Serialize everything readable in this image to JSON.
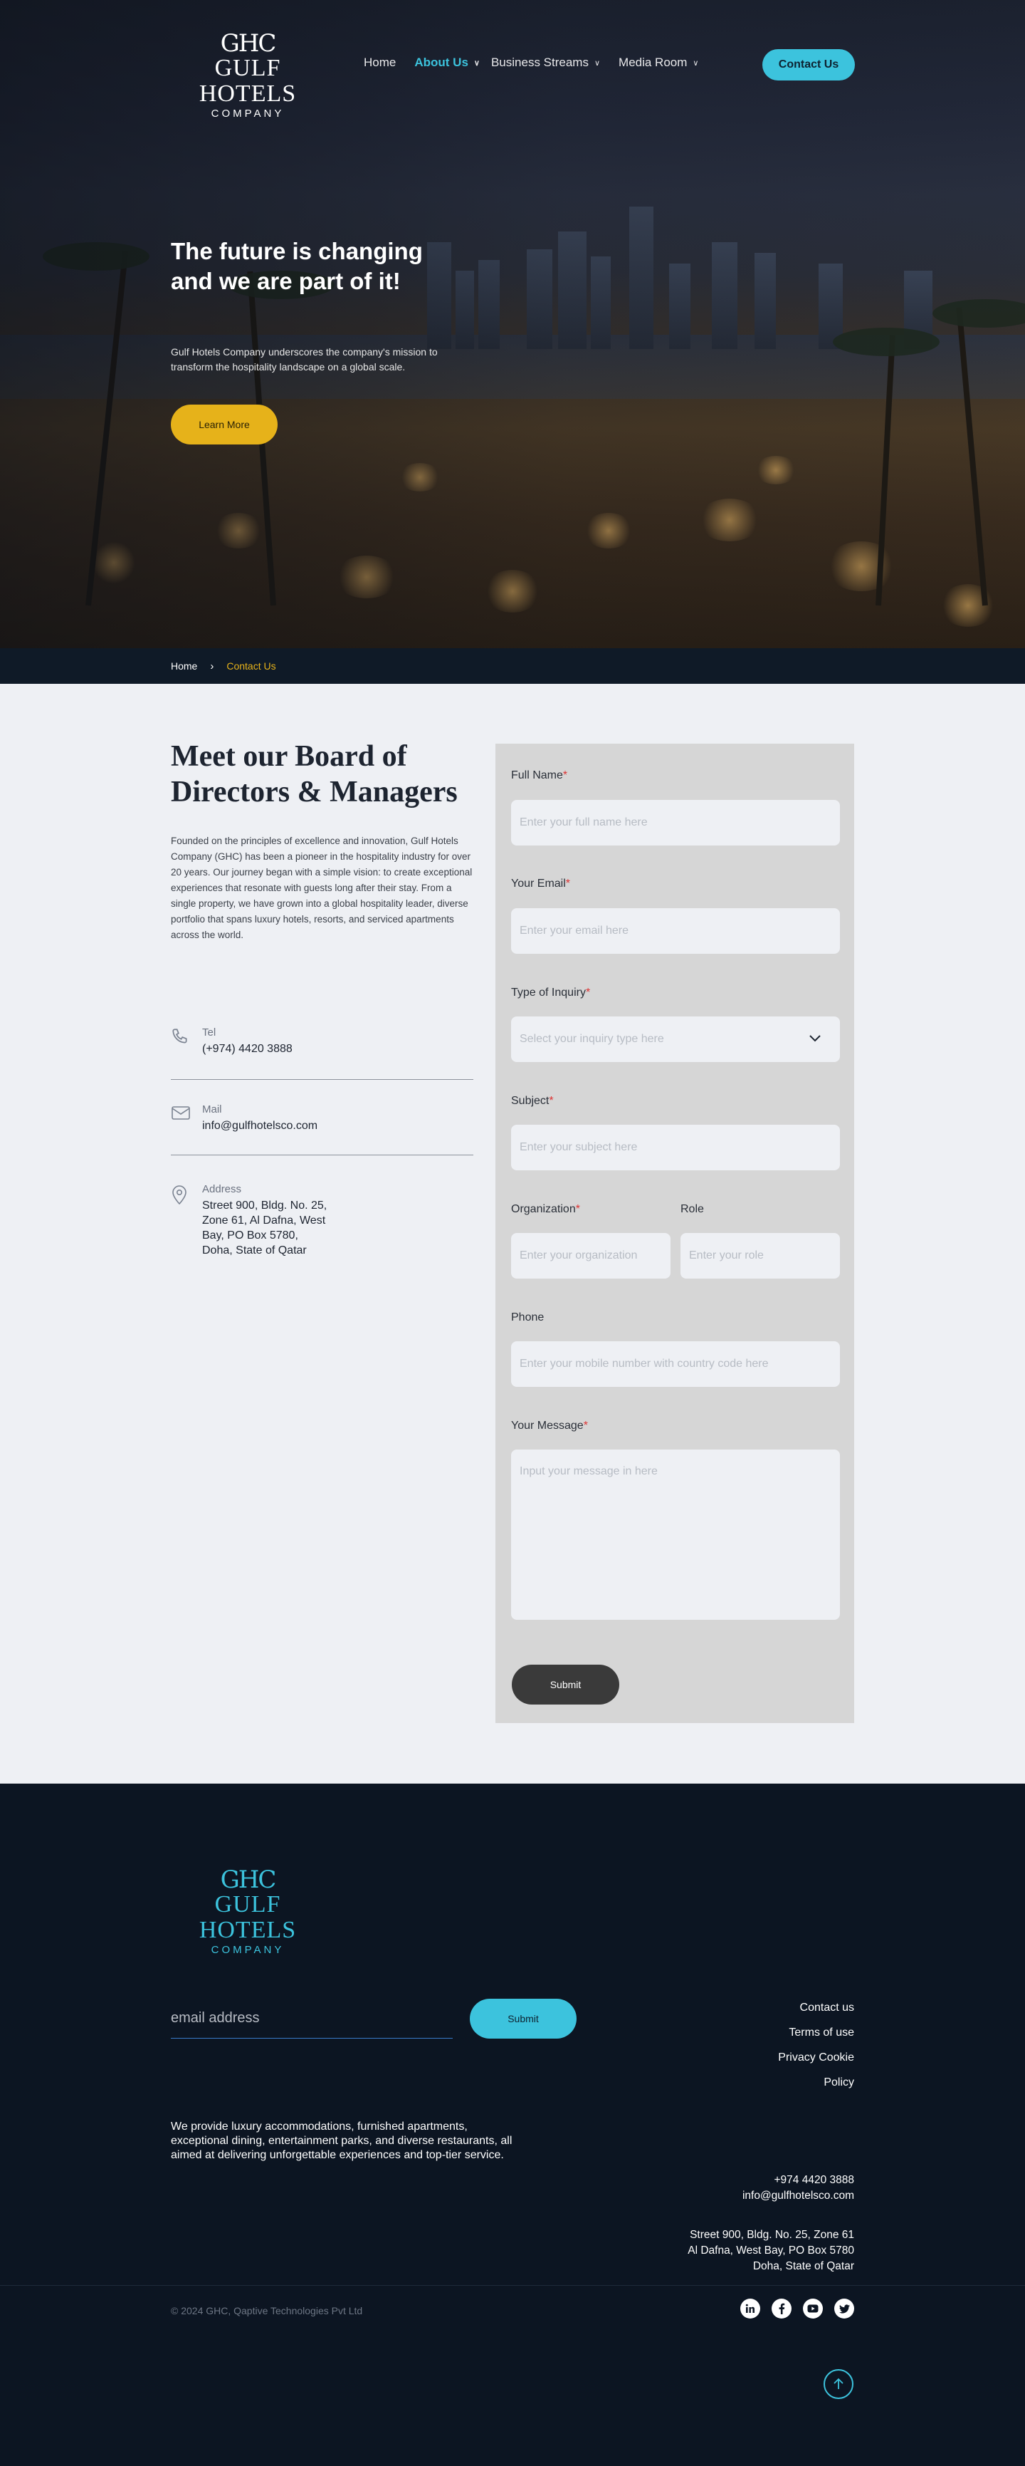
{
  "header": {
    "logo": {
      "mono": "GHC",
      "name": "GULF HOTELS",
      "sub": "COMPANY"
    },
    "nav": [
      {
        "label": "Home"
      },
      {
        "label": "About Us"
      },
      {
        "label": "Business Streams"
      },
      {
        "label": "Media Room"
      }
    ],
    "contact_button": "Contact Us"
  },
  "hero": {
    "title": "The future is changing and we are part of it!",
    "text": "Gulf Hotels Company underscores the company's mission to transform the hospitality landscape on a global scale.",
    "button": "Learn More"
  },
  "breadcrumb": {
    "home": "Home",
    "current": "Contact Us"
  },
  "board": {
    "title": "Meet our Board of Directors & Managers",
    "text": "Founded on the principles of excellence and innovation, Gulf Hotels Company (GHC) has been a pioneer in the hospitality industry for over 20 years. Our journey began with a simple vision: to create exceptional experiences that resonate with guests long after their stay. From a single property, we have grown into a global hospitality leader, diverse portfolio that spans luxury hotels, resorts, and serviced apartments across the world."
  },
  "contact_info": {
    "tel_label": "Tel",
    "tel_value": "(+974) 4420 3888",
    "mail_label": "Mail",
    "mail_value": "info@gulfhotelsco.com",
    "address_label": "Address",
    "address_value": "Street 900, Bldg. No. 25, Zone 61, Al Dafna, West Bay, PO Box 5780, Doha, State of Qatar"
  },
  "form": {
    "full_name_label": "Full Name",
    "full_name_placeholder": "Enter your full name here",
    "email_label": "Your Email",
    "email_placeholder": "Enter your email here",
    "inquiry_label": "Type of Inquiry",
    "inquiry_placeholder": "Select your inquiry type here",
    "subject_label": "Subject",
    "subject_placeholder": "Enter your subject here",
    "organization_label": "Organization",
    "organization_placeholder": "Enter your organization",
    "role_label": "Role",
    "role_placeholder": "Enter your role",
    "phone_label": "Phone",
    "phone_placeholder": "Enter your mobile number with country code here",
    "message_label": "Your Message",
    "message_placeholder": "Input your message in here",
    "required_mark": "*",
    "submit": "Submit"
  },
  "footer": {
    "logo": {
      "mono": "GHC",
      "name": "GULF HOTELS",
      "sub": "COMPANY"
    },
    "email_placeholder": "email address",
    "submit": "Submit",
    "links": [
      "Contact us",
      "Terms of use",
      "Privacy Cookie",
      "Policy"
    ],
    "description": "We provide luxury accommodations, furnished apartments, exceptional dining, entertainment parks, and diverse restaurants, all aimed at delivering unforgettable experiences and top-tier service.",
    "phone": "+974  4420  3888",
    "email": "info@gulfhotelsco.com",
    "address_line1": "Street 900, Bldg. No. 25, Zone 61",
    "address_line2": "Al Dafna, West Bay, PO Box 5780",
    "address_line3": "Doha, State of Qatar",
    "copyright": "© 2024 GHC, Qaptive Technologies Pvt Ltd",
    "socials": [
      "linkedin-icon",
      "facebook-icon",
      "youtube-icon",
      "twitter-icon"
    ]
  },
  "colors": {
    "accent": "#3cc3dd",
    "gold": "#e6b21a",
    "dark": "#0c1522",
    "form_bg": "#d6d6d6",
    "page_bg": "#eef0f4"
  }
}
